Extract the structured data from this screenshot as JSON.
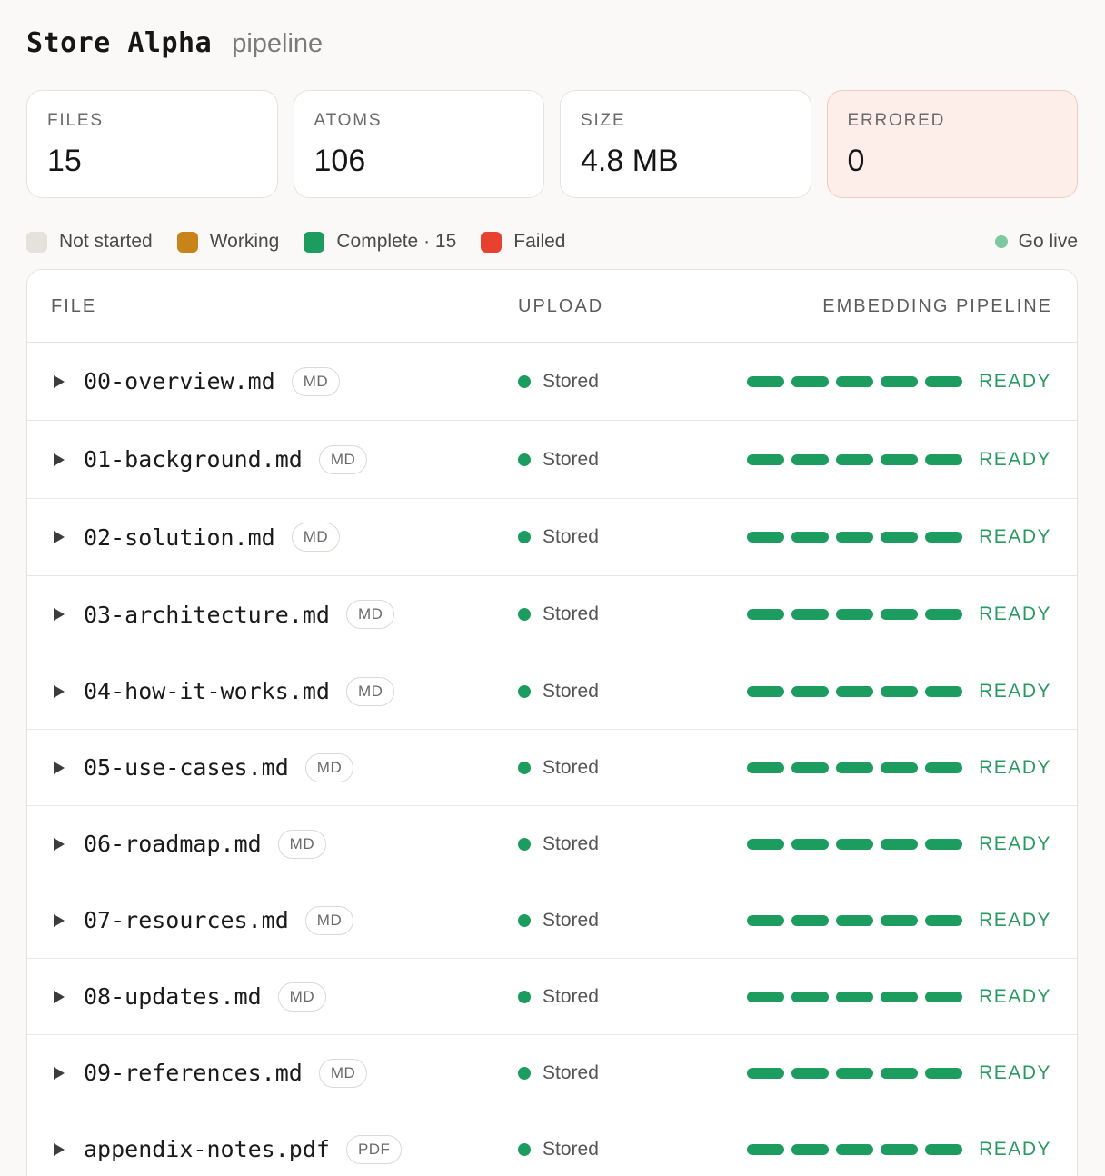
{
  "header": {
    "title": "Store Alpha",
    "subtitle": "pipeline"
  },
  "stats": [
    {
      "label": "FILES",
      "value": "15"
    },
    {
      "label": "ATOMS",
      "value": "106"
    },
    {
      "label": "SIZE",
      "value": "4.8 MB"
    },
    {
      "label": "ERRORED",
      "value": "0"
    }
  ],
  "legend": {
    "not_started": "Not started",
    "working": "Working",
    "complete": "Complete · 15",
    "failed": "Failed",
    "go_live": "Go live"
  },
  "colors": {
    "not_started": "#e5e2de",
    "working": "#c88418",
    "complete": "#1c9c5e",
    "failed": "#e8412f",
    "ready_text": "#2a9a62"
  },
  "table": {
    "columns": {
      "file": "FILE",
      "upload": "UPLOAD",
      "pipeline": "EMBEDDING PIPELINE"
    },
    "rows": [
      {
        "name": "00-overview.md",
        "type": "MD",
        "upload": "Stored",
        "status": "READY"
      },
      {
        "name": "01-background.md",
        "type": "MD",
        "upload": "Stored",
        "status": "READY"
      },
      {
        "name": "02-solution.md",
        "type": "MD",
        "upload": "Stored",
        "status": "READY"
      },
      {
        "name": "03-architecture.md",
        "type": "MD",
        "upload": "Stored",
        "status": "READY"
      },
      {
        "name": "04-how-it-works.md",
        "type": "MD",
        "upload": "Stored",
        "status": "READY"
      },
      {
        "name": "05-use-cases.md",
        "type": "MD",
        "upload": "Stored",
        "status": "READY"
      },
      {
        "name": "06-roadmap.md",
        "type": "MD",
        "upload": "Stored",
        "status": "READY"
      },
      {
        "name": "07-resources.md",
        "type": "MD",
        "upload": "Stored",
        "status": "READY"
      },
      {
        "name": "08-updates.md",
        "type": "MD",
        "upload": "Stored",
        "status": "READY"
      },
      {
        "name": "09-references.md",
        "type": "MD",
        "upload": "Stored",
        "status": "READY"
      },
      {
        "name": "appendix-notes.pdf",
        "type": "PDF",
        "upload": "Stored",
        "status": "READY"
      }
    ]
  }
}
